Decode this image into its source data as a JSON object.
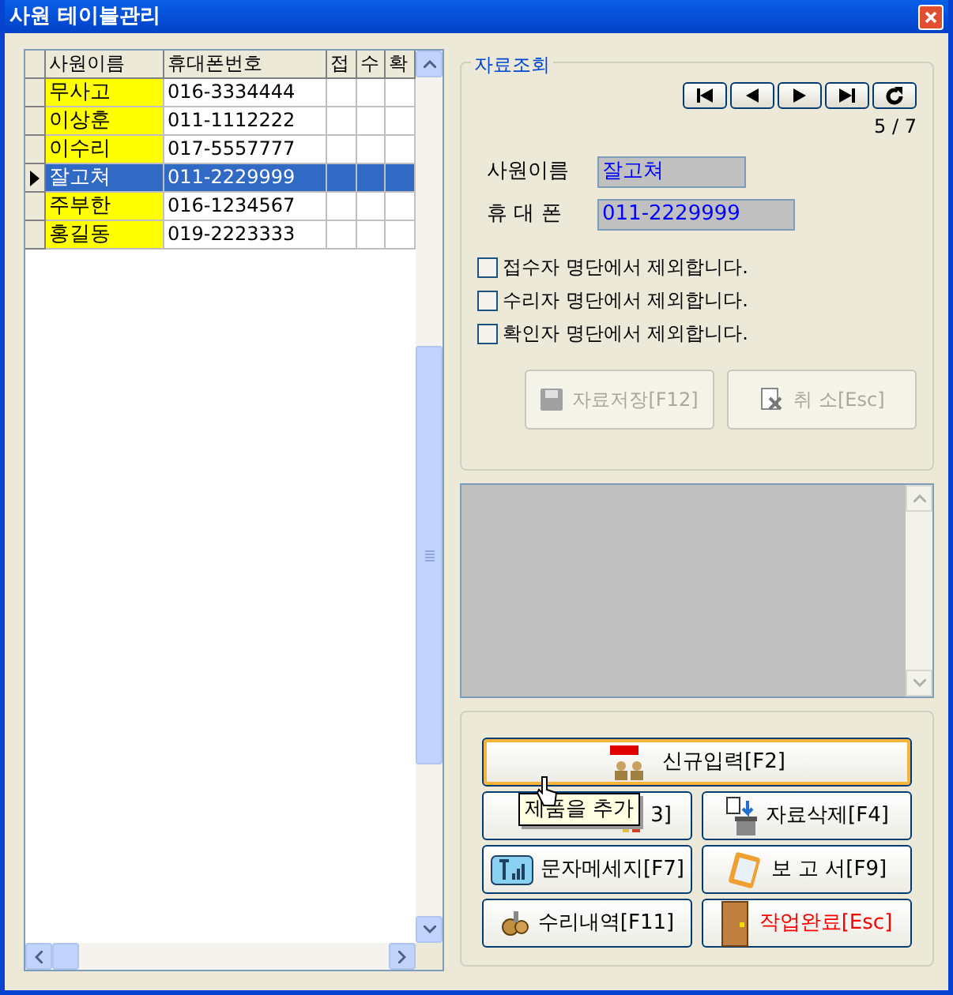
{
  "window": {
    "title": "사원 테이블관리"
  },
  "grid": {
    "columns": [
      "사원이름",
      "휴대폰번호",
      "접",
      "수",
      "확"
    ],
    "rows": [
      {
        "name": "무사고",
        "phone": "016-3334444",
        "selected": false
      },
      {
        "name": "이상훈",
        "phone": "011-1112222",
        "selected": false
      },
      {
        "name": "이수리",
        "phone": "017-5557777",
        "selected": false
      },
      {
        "name": "잘고쳐",
        "phone": "011-2229999",
        "selected": true
      },
      {
        "name": "주부한",
        "phone": "016-1234567",
        "selected": false
      },
      {
        "name": "홍길동",
        "phone": "019-2223333",
        "selected": false
      }
    ]
  },
  "lookup": {
    "title": "자료조회",
    "record": "5 / 7",
    "fields": [
      {
        "label": "사원이름",
        "value": "잘고쳐"
      },
      {
        "label": "휴 대 폰",
        "value": "011-2229999"
      }
    ],
    "checkboxes": [
      {
        "label": "접수자 명단에서 제외합니다.",
        "checked": false
      },
      {
        "label": "수리자 명단에서 제외합니다.",
        "checked": false
      },
      {
        "label": "확인자 명단에서 제외합니다.",
        "checked": false
      }
    ],
    "buttons": [
      {
        "label": "자료저장[F12]",
        "kind": "save",
        "disabled": true
      },
      {
        "label": "취 소[Esc]",
        "kind": "cancel",
        "disabled": true
      }
    ]
  },
  "actions": [
    {
      "label": "신규입력[F2]",
      "kind": "new",
      "focused": true,
      "danger": false
    },
    {
      "label": "3]",
      "kind": "add",
      "focused": false,
      "danger": false
    },
    {
      "label": "자료삭제[F4]",
      "kind": "delete",
      "focused": false,
      "danger": false
    },
    {
      "label": "문자메세지[F7]",
      "kind": "sms",
      "focused": false,
      "danger": false
    },
    {
      "label": "보 고 서[F9]",
      "kind": "report",
      "focused": false,
      "danger": false
    },
    {
      "label": "수리내역[F11]",
      "kind": "history",
      "focused": false,
      "danger": false
    },
    {
      "label": "작업완료[Esc]",
      "kind": "exit",
      "focused": false,
      "danger": true
    }
  ],
  "tooltip": "제품을 추가"
}
